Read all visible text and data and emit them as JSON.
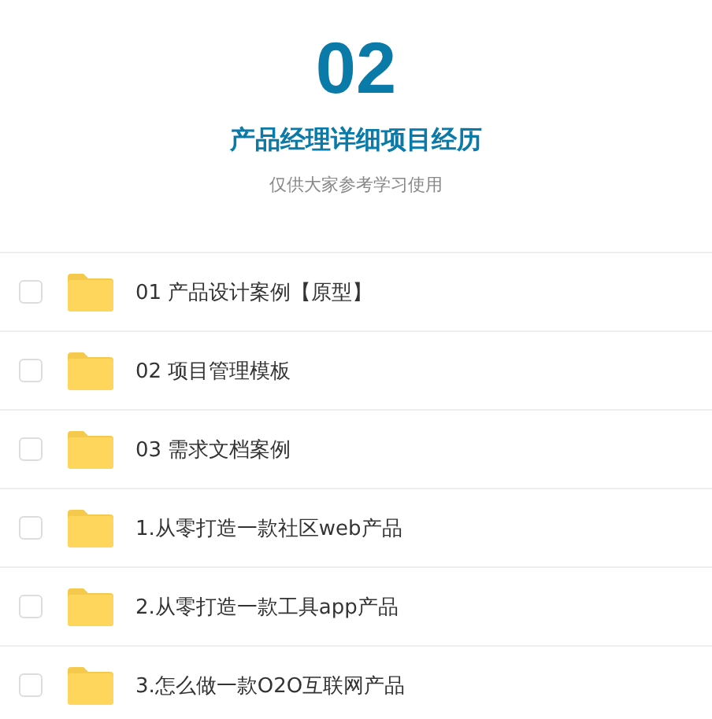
{
  "header": {
    "number": "02",
    "title": "产品经理详细项目经历",
    "subtitle": "仅供大家参考学习使用"
  },
  "files": [
    {
      "name": "01 产品设计案例【原型】",
      "kind": "folder",
      "checked": false
    },
    {
      "name": "02 项目管理模板",
      "kind": "folder",
      "checked": false
    },
    {
      "name": "03 需求文档案例",
      "kind": "folder",
      "checked": false
    },
    {
      "name": "1.从零打造一款社区web产品",
      "kind": "folder",
      "checked": false
    },
    {
      "name": "2.从零打造一款工具app产品",
      "kind": "folder",
      "checked": false
    },
    {
      "name": "3.怎么做一款O2O互联网产品",
      "kind": "folder",
      "checked": false
    }
  ]
}
